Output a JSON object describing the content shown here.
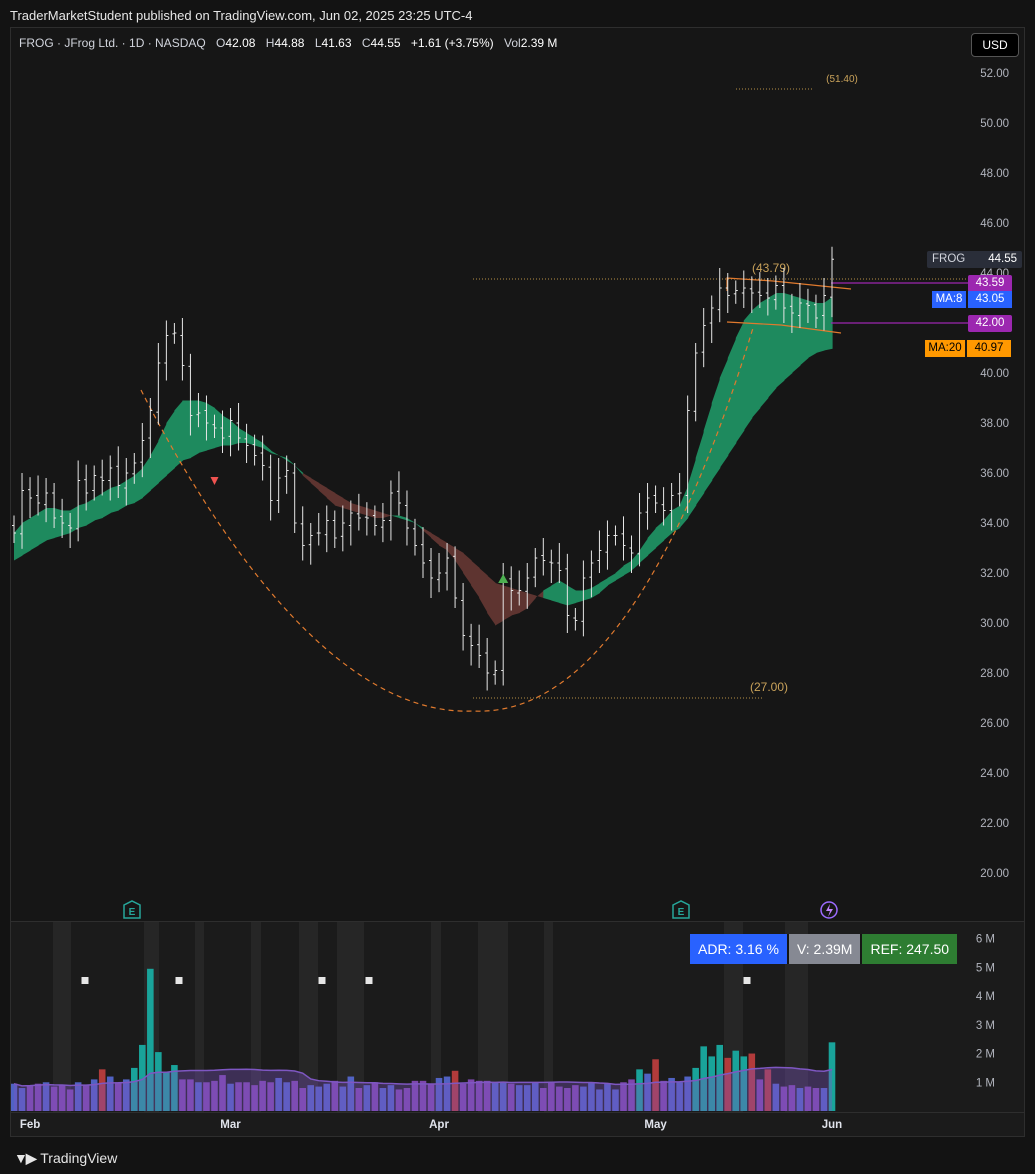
{
  "publish_line": "TraderMarketStudent published on TradingView.com, Jun 02, 2025 23:25 UTC-4",
  "legend": {
    "symbol": "FROG · JFrog Ltd. · 1D · NASDAQ",
    "o_label": "O",
    "o": "42.08",
    "h_label": "H",
    "h": "44.88",
    "l_label": "L",
    "l": "41.63",
    "c_label": "C",
    "c": "44.55",
    "change": "+1.61 (+3.75%)",
    "vol_label": "Vol",
    "vol": "2.39 M"
  },
  "currency_button": "USD",
  "price_tags": {
    "symbol": {
      "label": "FROG",
      "value": "44.55"
    },
    "upper_level": "43.59",
    "ma8": {
      "label": "MA:8",
      "value": "43.05"
    },
    "lower_level": "42.00",
    "ma20": {
      "label": "MA:20",
      "value": "40.97"
    }
  },
  "annotations": [
    "(51.40)",
    "(43.79)",
    "(27.00)"
  ],
  "volume_badges": {
    "adr": "ADR: 3.16 %",
    "v": "V: 2.39M",
    "ref": "REF: 247.50"
  },
  "footer": "TradingView",
  "colors": {
    "background": "#151515",
    "up_cloud": "#1e8a5e",
    "down_cloud": "#5e3430",
    "ma8_tag": "#2962ff",
    "ma20_tag": "#ff9800",
    "level_tag": "#9c27b0",
    "volume_up": "#19a39a",
    "volume_down": "#b23b3b",
    "volume_ma": "#7e57c2",
    "arc": "#e07a2e"
  },
  "chart_data": {
    "type": "line",
    "y_axis_ticks": [
      "52.00",
      "50.00",
      "48.00",
      "46.00",
      "44.00",
      "42.00",
      "40.00",
      "38.00",
      "36.00",
      "34.00",
      "32.00",
      "30.00",
      "28.00",
      "26.00",
      "24.00",
      "22.00",
      "20.00"
    ],
    "y_range": [
      19,
      53
    ],
    "x_axis_ticks": [
      "Feb",
      "Mar",
      "Apr",
      "May",
      "Jun"
    ],
    "volume_axis_ticks": [
      "6 M",
      "5 M",
      "4 M",
      "3 M",
      "2 M",
      "1 M"
    ],
    "volume_range_millions": [
      0,
      6.3
    ],
    "close": [
      33.6,
      35.3,
      35.0,
      34.8,
      35.2,
      34.2,
      34.0,
      33.8,
      35.7,
      35.2,
      35.9,
      35.7,
      36.2,
      35.5,
      36.0,
      36.4,
      37.3,
      38.5,
      40.4,
      41.5,
      41.6,
      40.3,
      38.3,
      38.4,
      38.0,
      37.8,
      37.4,
      38.1,
      37.4,
      37.1,
      36.7,
      36.3,
      34.9,
      35.8,
      36.1,
      34.0,
      33.1,
      33.5,
      33.6,
      34.1,
      33.4,
      34.0,
      34.4,
      34.2,
      34.2,
      33.9,
      34.1,
      35.2,
      34.8,
      33.8,
      33.1,
      32.4,
      31.8,
      32.0,
      32.6,
      31.0,
      29.5,
      29.1,
      28.7,
      28.0,
      28.1,
      31.7,
      31.3,
      31.3,
      31.8,
      32.6,
      32.5,
      32.4,
      32.1,
      30.3,
      30.1,
      31.8,
      32.4,
      32.9,
      33.5,
      33.5,
      33.1,
      32.8,
      34.4,
      35.0,
      34.8,
      34.5,
      35.1,
      35.2,
      38.5,
      40.8,
      41.9,
      42.6,
      43.4,
      43.1,
      43.3,
      43.4,
      43.2,
      43.1,
      43.0,
      43.5,
      42.6,
      42.4,
      42.8,
      42.7,
      42.2,
      43.1,
      44.55
    ],
    "volume_millions": [
      0.95,
      0.8,
      0.9,
      0.95,
      1.0,
      0.85,
      0.9,
      0.75,
      1.0,
      0.9,
      1.1,
      1.45,
      1.2,
      1.0,
      1.1,
      1.5,
      2.3,
      4.95,
      2.05,
      1.35,
      1.6,
      1.1,
      1.1,
      1.0,
      1.0,
      1.05,
      1.25,
      0.95,
      1.0,
      1.0,
      0.9,
      1.05,
      1.0,
      1.15,
      1.0,
      1.05,
      0.8,
      0.9,
      0.85,
      0.95,
      1.05,
      0.85,
      1.2,
      0.8,
      0.9,
      1.0,
      0.8,
      0.9,
      0.75,
      0.8,
      1.05,
      1.05,
      0.95,
      1.15,
      1.2,
      1.4,
      0.95,
      1.1,
      1.05,
      1.05,
      1.0,
      1.0,
      0.95,
      0.9,
      0.9,
      1.0,
      0.8,
      1.0,
      0.85,
      0.8,
      0.9,
      0.85,
      1.0,
      0.75,
      0.95,
      0.75,
      1.0,
      1.1,
      1.45,
      1.3,
      1.8,
      1.05,
      1.15,
      1.0,
      1.2,
      1.5,
      2.25,
      1.9,
      2.3,
      1.85,
      2.1,
      1.9,
      2.0,
      1.1,
      1.45,
      0.95,
      0.85,
      0.9,
      0.8,
      0.85,
      0.8,
      0.8,
      2.39
    ],
    "ma8": [
      33.6,
      34.0,
      34.2,
      34.4,
      34.6,
      34.6,
      34.5,
      34.5,
      34.7,
      34.8,
      35.0,
      35.2,
      35.4,
      35.5,
      35.7,
      35.9,
      36.2,
      36.7,
      37.3,
      38.0,
      38.5,
      38.9,
      38.9,
      38.9,
      38.8,
      38.6,
      38.3,
      38.1,
      37.8,
      37.6,
      37.4,
      37.2,
      36.9,
      36.7,
      36.6,
      36.3,
      35.9,
      35.6,
      35.3,
      35.0,
      34.7,
      34.6,
      34.5,
      34.4,
      34.3,
      34.2,
      34.2,
      34.3,
      34.3,
      34.2,
      34.0,
      33.7,
      33.4,
      33.1,
      32.9,
      32.5,
      32.0,
      31.5,
      31.0,
      30.4,
      29.9,
      30.1,
      30.3,
      30.4,
      30.6,
      31.0,
      31.3,
      31.5,
      31.7,
      31.5,
      31.3,
      31.3,
      31.4,
      31.6,
      31.8,
      32.0,
      32.3,
      32.5,
      32.9,
      33.4,
      33.8,
      34.1,
      34.5,
      34.7,
      35.5,
      36.6,
      37.7,
      38.8,
      39.8,
      40.6,
      41.4,
      42.1,
      42.5,
      42.8,
      43.0,
      43.2,
      43.2,
      43.1,
      43.0,
      42.9,
      42.8,
      42.8,
      43.05
    ],
    "ma20": [
      32.5,
      32.7,
      32.9,
      33.1,
      33.3,
      33.4,
      33.5,
      33.6,
      33.8,
      33.9,
      34.1,
      34.2,
      34.4,
      34.5,
      34.7,
      34.8,
      35.0,
      35.3,
      35.6,
      35.9,
      36.2,
      36.5,
      36.6,
      36.8,
      36.9,
      37.0,
      37.1,
      37.1,
      37.2,
      37.2,
      37.1,
      37.0,
      36.8,
      36.7,
      36.5,
      36.3,
      36.0,
      35.8,
      35.6,
      35.4,
      35.2,
      35.0,
      34.8,
      34.7,
      34.6,
      34.5,
      34.4,
      34.3,
      34.2,
      34.1,
      34.0,
      33.8,
      33.6,
      33.4,
      33.2,
      33.0,
      32.8,
      32.5,
      32.2,
      31.9,
      31.6,
      31.5,
      31.4,
      31.3,
      31.2,
      31.1,
      31.0,
      30.9,
      30.8,
      30.7,
      30.8,
      30.9,
      31.0,
      31.2,
      31.5,
      31.7,
      31.9,
      32.1,
      32.4,
      32.7,
      33.0,
      33.3,
      33.6,
      33.8,
      34.2,
      34.7,
      35.2,
      35.7,
      36.2,
      36.7,
      37.2,
      37.7,
      38.2,
      38.6,
      39.0,
      39.4,
      39.7,
      40.0,
      40.3,
      40.6,
      40.8,
      40.9,
      40.97
    ]
  }
}
